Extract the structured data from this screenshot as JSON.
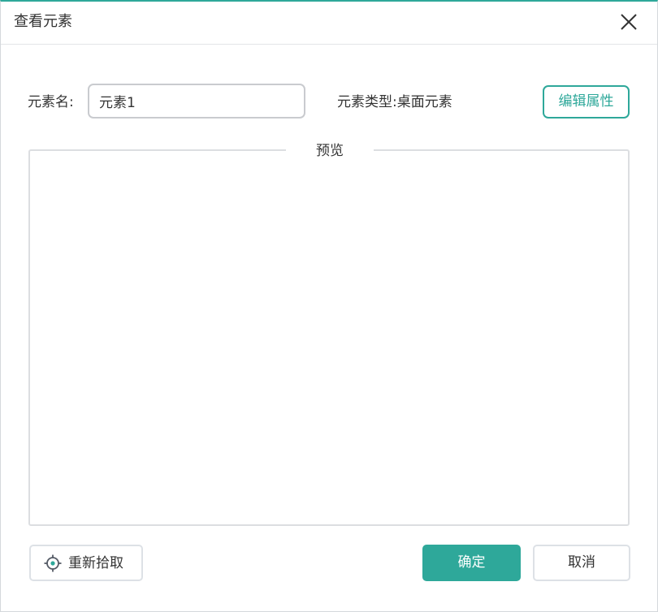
{
  "dialog": {
    "title": "查看元素",
    "close_icon": "close-icon",
    "accent_color": "#2ea89a"
  },
  "form": {
    "name_label": "元素名:",
    "name_value": "元素1",
    "type_label": "元素类型:桌面元素",
    "edit_button_label": "编辑属性"
  },
  "preview": {
    "legend": "预览"
  },
  "footer": {
    "repick_icon": "target-icon",
    "repick_label": "重新拾取",
    "ok_label": "确定",
    "cancel_label": "取消"
  }
}
